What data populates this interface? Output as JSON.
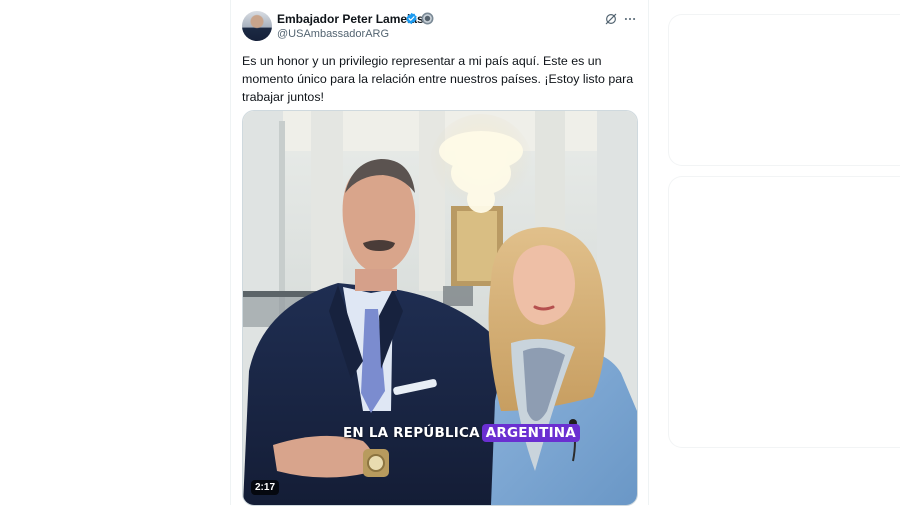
{
  "author": {
    "display_name": "Embajador Peter Lamelas",
    "handle": "@USAmbassadorARG"
  },
  "icons": {
    "verified": "verified-badge-icon",
    "government": "government-affiliation-icon",
    "grok": "grok-icon",
    "more": "more-options-icon"
  },
  "tweet": {
    "text": "Es un honor y un privilegio representar a mi país aquí. Este es un\nmomento único para la relación entre nuestros países. ¡Estoy listo para\ntrabajar juntos!"
  },
  "video": {
    "caption_prefix": "EN LA REPÚBLICA",
    "caption_highlight": "ARGENTINA",
    "duration": "2:17"
  },
  "colors": {
    "verified_blue": "#1d9bf0",
    "caption_highlight": "#6a2fd1",
    "secondary_text": "#536471"
  }
}
